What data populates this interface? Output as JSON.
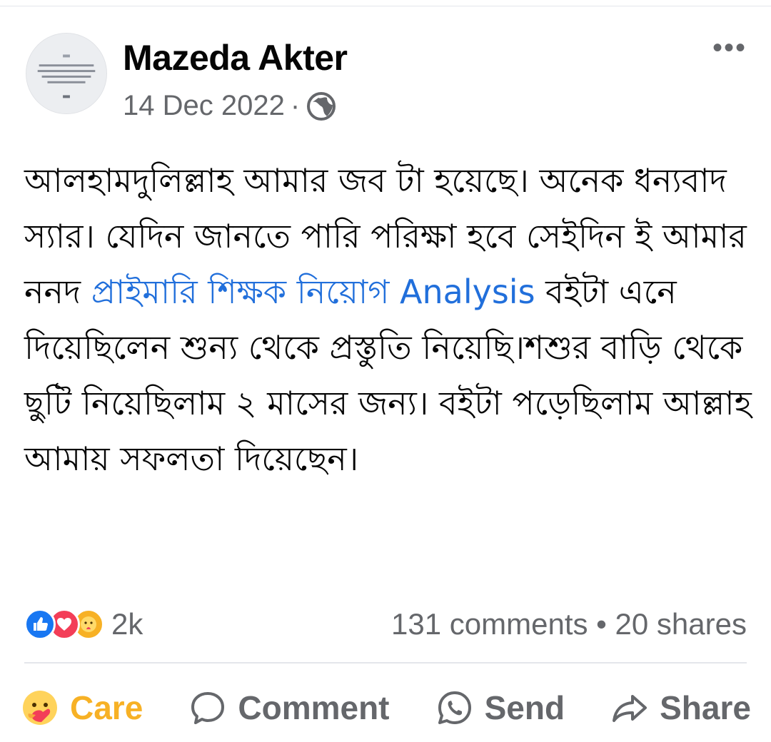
{
  "post": {
    "author": "Mazeda Akter",
    "date": "14 Dec 2022",
    "separator": "·",
    "privacy_icon": "globe-icon",
    "more_icon": "•••",
    "text_before_link": "আলহামদুলিল্লাহ আমার জব টা হয়েছে। অনেক ধন্যবাদ স্যার। যেদিন জানতে পারি পরিক্ষা হবে সেইদিন ই আমার ননদ ",
    "link_text": "প্রাইমারি শিক্ষক নিয়োগ Analysis",
    "text_after_link": " বইটা এনে দিয়েছিলেন শুন্য থেকে প্রস্তুতি নিয়েছি।শশুর বাড়ি থেকে ছুটি নিয়েছিলাম ২ মাসের জন্য। বইটা পড়েছিলাম আল্লাহ আমায় সফলতা দিয়েছেন।"
  },
  "stats": {
    "reactions": [
      "like-icon",
      "love-icon",
      "care-icon"
    ],
    "reaction_count": "2k",
    "comments_shares": "131 comments • 20 shares"
  },
  "actions": {
    "care": "Care",
    "comment": "Comment",
    "send": "Send",
    "share": "Share"
  },
  "colors": {
    "link": "#216fdb",
    "like": "#1877f2",
    "love": "#f33e58",
    "care": "#f7b125",
    "muted": "#65676b"
  }
}
